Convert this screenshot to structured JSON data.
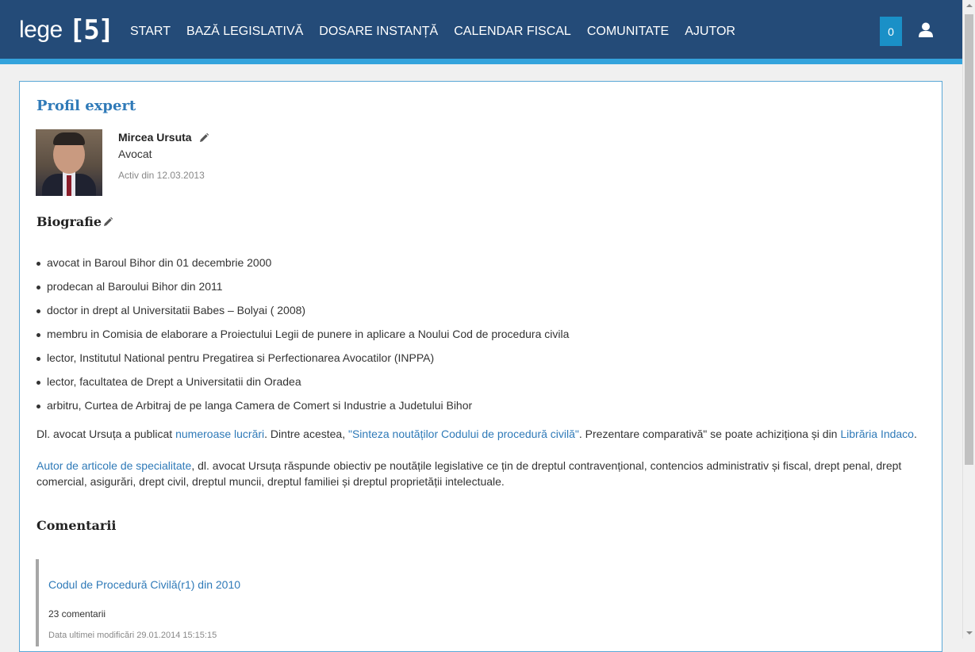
{
  "header": {
    "logo_text": "lege",
    "logo_box": "[5]",
    "nav": [
      "START",
      "BAZĂ LEGISLATIVĂ",
      "DOSARE INSTANȚĂ",
      "CALENDAR FISCAL",
      "COMUNITATE",
      "AJUTOR"
    ],
    "badge_count": "0",
    "colors": {
      "bar": "#244b78",
      "stripe": "#34a3dc",
      "badge": "#1a90c7"
    }
  },
  "profile": {
    "title": "Profil expert",
    "name": "Mircea Ursuta",
    "role": "Avocat",
    "active_since": "Activ din 12.03.2013"
  },
  "biography": {
    "title": "Biografie",
    "items": [
      "avocat in Baroul Bihor din 01 decembrie 2000",
      "prodecan al Baroului Bihor din 2011",
      "doctor in drept al Universitatii Babes – Bolyai ( 2008)",
      "membru in Comisia de elaborare a Proiectului Legii de punere in aplicare a Noului Cod de procedura civila",
      "lector, Institutul National pentru Pregatirea si Perfectionarea Avocatilor (INPPA)",
      "lector, facultatea de Drept a Universitatii din Oradea",
      "arbitru, Curtea de Arbitraj de pe langa Camera de Comert si Industrie a Judetului Bihor"
    ],
    "p1_a": "Dl. avocat Ursuța a publicat ",
    "p1_link1": "numeroase lucrări",
    "p1_b": ". Dintre acestea, ",
    "p1_link2": "\"Sinteza noutăților Codului de procedură civilă\"",
    "p1_c": ". Prezentare comparativă\" se poate achiziționa și din ",
    "p1_link3": "Librăria Indaco",
    "p1_d": ".",
    "p2_link": "Autor de articole de specialitate",
    "p2_text": ", dl. avocat Ursuța răspunde obiectiv pe noutățile legislative ce țin de dreptul contravențional, contencios administrativ și fiscal, drept penal, drept comercial, asigurări, drept civil, dreptul muncii, dreptul familiei și dreptul proprietății intelectuale."
  },
  "comments": {
    "title": "Comentarii",
    "items": [
      {
        "link": "Codul de Procedură Civilă(r1) din 2010",
        "count": "23 comentarii",
        "date": "Data ultimei modificări 29.01.2014 15:15:15"
      }
    ]
  }
}
